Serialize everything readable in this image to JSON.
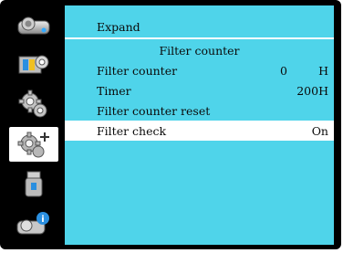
{
  "sidebar": {
    "items": [
      {
        "icon": "projector-image-icon"
      },
      {
        "icon": "display-settings-icon"
      },
      {
        "icon": "gear-settings-icon"
      },
      {
        "icon": "gear-plus-expand-icon",
        "active": true
      },
      {
        "icon": "usb-memory-icon"
      },
      {
        "icon": "projector-info-icon"
      }
    ]
  },
  "panel": {
    "title": "Expand",
    "subtitle": "Filter counter",
    "rows": [
      {
        "label": "Filter counter",
        "value": "0",
        "unit": "H"
      },
      {
        "label": "Timer",
        "value": "200H"
      },
      {
        "label": "Filter counter reset",
        "value": ""
      },
      {
        "label": "Filter check",
        "value": "On"
      }
    ]
  },
  "colors": {
    "panel_bg": "#4fd4ea",
    "selected_bg": "#ffffff",
    "frame": "#000000"
  }
}
